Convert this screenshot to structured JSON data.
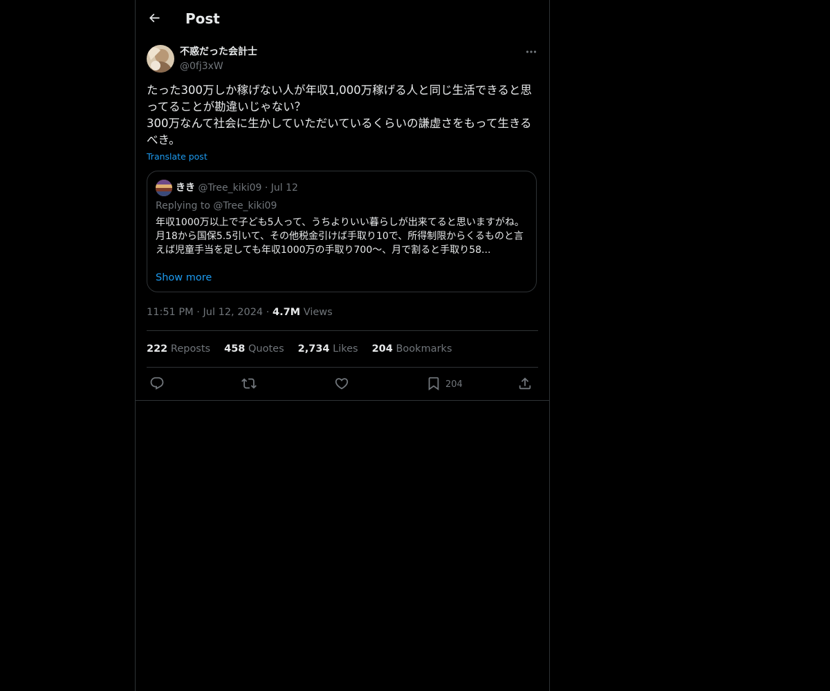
{
  "colors": {
    "background": "#000000",
    "text": "#e7e9ea",
    "muted": "#71767b",
    "accent": "#1d9bf0",
    "border": "#2f3336"
  },
  "header": {
    "back_icon": "arrow-left-icon",
    "title": "Post"
  },
  "post": {
    "author": {
      "name": "不惑だった会計士",
      "handle": "@0fj3xW"
    },
    "more_icon": "more-horizontal-icon",
    "text": "たった300万しか稼げない人が年収1,000万稼げる人と同じ生活できると思ってることが勘違いじゃない？\n300万なんて社会に生かしていただいているくらいの謙虚さをもって生きるべき。",
    "translate_label": "Translate post",
    "quote": {
      "name": "きき",
      "handle": "@Tree_kiki09",
      "separator": "·",
      "date": "Jul 12",
      "replying_prefix": "Replying to",
      "replying_handle": "@Tree_kiki09",
      "text": "年収1000万以上で子ども5人って、うちよりいい暮らしが出来てると思いますがね。\n月18から国保5.5引いて、その他税金引けば手取り10で、所得制限からくるものと言えば児童手当を足しても年収1000万の手取り700〜、月で割ると手取り58...",
      "show_more_label": "Show more"
    },
    "meta": {
      "time": "11:51 PM",
      "separator": "·",
      "date": "Jul 12, 2024",
      "views_count": "4.7M",
      "views_label": "Views"
    },
    "stats": [
      {
        "count": "222",
        "label": "Reposts"
      },
      {
        "count": "458",
        "label": "Quotes"
      },
      {
        "count": "2,734",
        "label": "Likes"
      },
      {
        "count": "204",
        "label": "Bookmarks"
      }
    ],
    "actions": {
      "reply_icon": "reply-icon",
      "repost_icon": "repost-icon",
      "like_icon": "heart-icon",
      "bookmark_icon": "bookmark-icon",
      "bookmark_count": "204",
      "share_icon": "share-icon"
    }
  }
}
